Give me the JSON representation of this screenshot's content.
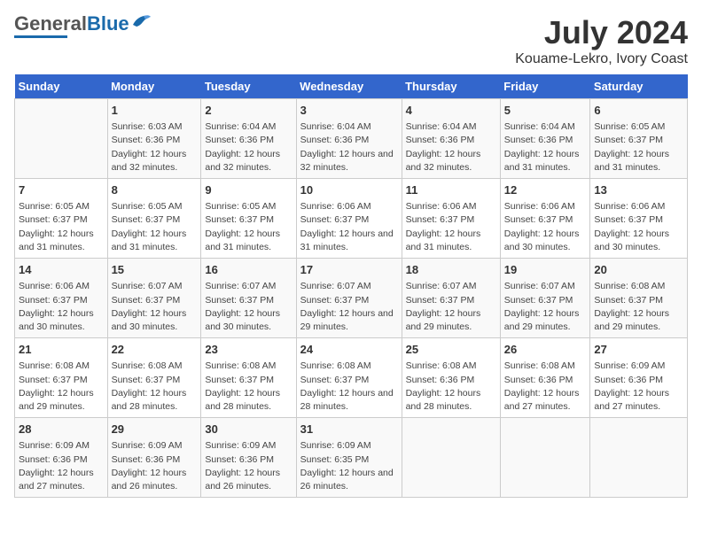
{
  "logo": {
    "name_part1": "General",
    "name_part2": "Blue"
  },
  "title": "July 2024",
  "subtitle": "Kouame-Lekro, Ivory Coast",
  "days_of_week": [
    "Sunday",
    "Monday",
    "Tuesday",
    "Wednesday",
    "Thursday",
    "Friday",
    "Saturday"
  ],
  "weeks": [
    [
      {
        "day": "",
        "sunrise": "",
        "sunset": "",
        "daylight": ""
      },
      {
        "day": "1",
        "sunrise": "Sunrise: 6:03 AM",
        "sunset": "Sunset: 6:36 PM",
        "daylight": "Daylight: 12 hours and 32 minutes."
      },
      {
        "day": "2",
        "sunrise": "Sunrise: 6:04 AM",
        "sunset": "Sunset: 6:36 PM",
        "daylight": "Daylight: 12 hours and 32 minutes."
      },
      {
        "day": "3",
        "sunrise": "Sunrise: 6:04 AM",
        "sunset": "Sunset: 6:36 PM",
        "daylight": "Daylight: 12 hours and 32 minutes."
      },
      {
        "day": "4",
        "sunrise": "Sunrise: 6:04 AM",
        "sunset": "Sunset: 6:36 PM",
        "daylight": "Daylight: 12 hours and 32 minutes."
      },
      {
        "day": "5",
        "sunrise": "Sunrise: 6:04 AM",
        "sunset": "Sunset: 6:36 PM",
        "daylight": "Daylight: 12 hours and 31 minutes."
      },
      {
        "day": "6",
        "sunrise": "Sunrise: 6:05 AM",
        "sunset": "Sunset: 6:37 PM",
        "daylight": "Daylight: 12 hours and 31 minutes."
      }
    ],
    [
      {
        "day": "7",
        "sunrise": "Sunrise: 6:05 AM",
        "sunset": "Sunset: 6:37 PM",
        "daylight": "Daylight: 12 hours and 31 minutes."
      },
      {
        "day": "8",
        "sunrise": "Sunrise: 6:05 AM",
        "sunset": "Sunset: 6:37 PM",
        "daylight": "Daylight: 12 hours and 31 minutes."
      },
      {
        "day": "9",
        "sunrise": "Sunrise: 6:05 AM",
        "sunset": "Sunset: 6:37 PM",
        "daylight": "Daylight: 12 hours and 31 minutes."
      },
      {
        "day": "10",
        "sunrise": "Sunrise: 6:06 AM",
        "sunset": "Sunset: 6:37 PM",
        "daylight": "Daylight: 12 hours and 31 minutes."
      },
      {
        "day": "11",
        "sunrise": "Sunrise: 6:06 AM",
        "sunset": "Sunset: 6:37 PM",
        "daylight": "Daylight: 12 hours and 31 minutes."
      },
      {
        "day": "12",
        "sunrise": "Sunrise: 6:06 AM",
        "sunset": "Sunset: 6:37 PM",
        "daylight": "Daylight: 12 hours and 30 minutes."
      },
      {
        "day": "13",
        "sunrise": "Sunrise: 6:06 AM",
        "sunset": "Sunset: 6:37 PM",
        "daylight": "Daylight: 12 hours and 30 minutes."
      }
    ],
    [
      {
        "day": "14",
        "sunrise": "Sunrise: 6:06 AM",
        "sunset": "Sunset: 6:37 PM",
        "daylight": "Daylight: 12 hours and 30 minutes."
      },
      {
        "day": "15",
        "sunrise": "Sunrise: 6:07 AM",
        "sunset": "Sunset: 6:37 PM",
        "daylight": "Daylight: 12 hours and 30 minutes."
      },
      {
        "day": "16",
        "sunrise": "Sunrise: 6:07 AM",
        "sunset": "Sunset: 6:37 PM",
        "daylight": "Daylight: 12 hours and 30 minutes."
      },
      {
        "day": "17",
        "sunrise": "Sunrise: 6:07 AM",
        "sunset": "Sunset: 6:37 PM",
        "daylight": "Daylight: 12 hours and 29 minutes."
      },
      {
        "day": "18",
        "sunrise": "Sunrise: 6:07 AM",
        "sunset": "Sunset: 6:37 PM",
        "daylight": "Daylight: 12 hours and 29 minutes."
      },
      {
        "day": "19",
        "sunrise": "Sunrise: 6:07 AM",
        "sunset": "Sunset: 6:37 PM",
        "daylight": "Daylight: 12 hours and 29 minutes."
      },
      {
        "day": "20",
        "sunrise": "Sunrise: 6:08 AM",
        "sunset": "Sunset: 6:37 PM",
        "daylight": "Daylight: 12 hours and 29 minutes."
      }
    ],
    [
      {
        "day": "21",
        "sunrise": "Sunrise: 6:08 AM",
        "sunset": "Sunset: 6:37 PM",
        "daylight": "Daylight: 12 hours and 29 minutes."
      },
      {
        "day": "22",
        "sunrise": "Sunrise: 6:08 AM",
        "sunset": "Sunset: 6:37 PM",
        "daylight": "Daylight: 12 hours and 28 minutes."
      },
      {
        "day": "23",
        "sunrise": "Sunrise: 6:08 AM",
        "sunset": "Sunset: 6:37 PM",
        "daylight": "Daylight: 12 hours and 28 minutes."
      },
      {
        "day": "24",
        "sunrise": "Sunrise: 6:08 AM",
        "sunset": "Sunset: 6:37 PM",
        "daylight": "Daylight: 12 hours and 28 minutes."
      },
      {
        "day": "25",
        "sunrise": "Sunrise: 6:08 AM",
        "sunset": "Sunset: 6:36 PM",
        "daylight": "Daylight: 12 hours and 28 minutes."
      },
      {
        "day": "26",
        "sunrise": "Sunrise: 6:08 AM",
        "sunset": "Sunset: 6:36 PM",
        "daylight": "Daylight: 12 hours and 27 minutes."
      },
      {
        "day": "27",
        "sunrise": "Sunrise: 6:09 AM",
        "sunset": "Sunset: 6:36 PM",
        "daylight": "Daylight: 12 hours and 27 minutes."
      }
    ],
    [
      {
        "day": "28",
        "sunrise": "Sunrise: 6:09 AM",
        "sunset": "Sunset: 6:36 PM",
        "daylight": "Daylight: 12 hours and 27 minutes."
      },
      {
        "day": "29",
        "sunrise": "Sunrise: 6:09 AM",
        "sunset": "Sunset: 6:36 PM",
        "daylight": "Daylight: 12 hours and 26 minutes."
      },
      {
        "day": "30",
        "sunrise": "Sunrise: 6:09 AM",
        "sunset": "Sunset: 6:36 PM",
        "daylight": "Daylight: 12 hours and 26 minutes."
      },
      {
        "day": "31",
        "sunrise": "Sunrise: 6:09 AM",
        "sunset": "Sunset: 6:35 PM",
        "daylight": "Daylight: 12 hours and 26 minutes."
      },
      {
        "day": "",
        "sunrise": "",
        "sunset": "",
        "daylight": ""
      },
      {
        "day": "",
        "sunrise": "",
        "sunset": "",
        "daylight": ""
      },
      {
        "day": "",
        "sunrise": "",
        "sunset": "",
        "daylight": ""
      }
    ]
  ]
}
